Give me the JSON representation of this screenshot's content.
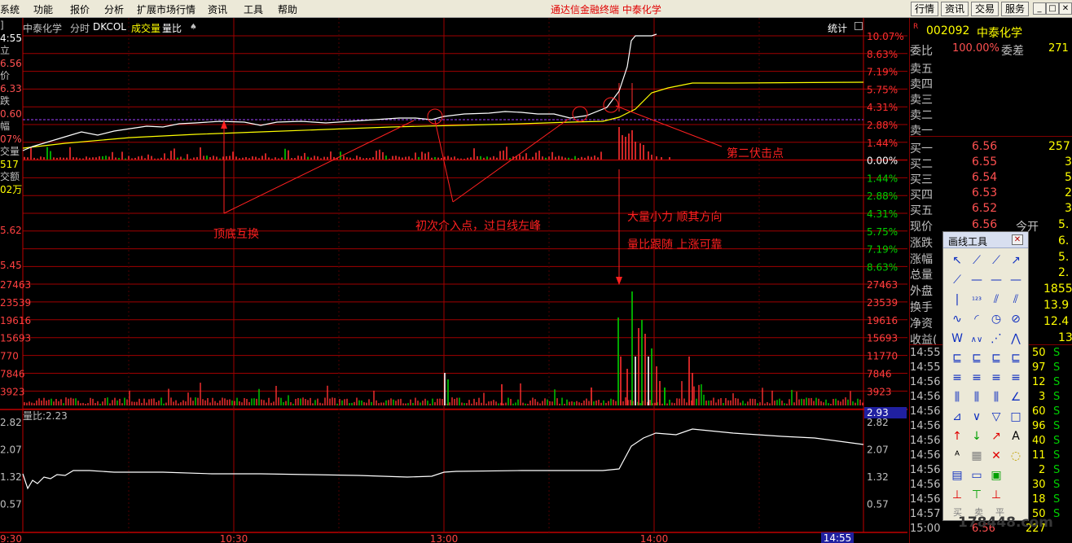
{
  "menu": [
    "系统",
    "功能",
    "报价",
    "分析",
    "扩展市场行情",
    "资讯",
    "工具",
    "帮助"
  ],
  "window_title": "通达信金融终端   中泰化学",
  "right_buttons": [
    "行情",
    "资讯",
    "交易",
    "服务"
  ],
  "window_controls": [
    "_",
    "□",
    "✕"
  ],
  "chart_header": {
    "stock": "中泰化学",
    "mode": "分时",
    "indicator": "DKCOL",
    "volume": "成交量",
    "ratio": "量比",
    "arrow": "♠",
    "stat": "统计"
  },
  "left_info": [
    {
      "text": "]",
      "color": "#c0c0c0"
    },
    {
      "text": "4:55",
      "color": "#ffffff"
    },
    {
      "text": "立",
      "color": "#c0c0c0"
    },
    {
      "text": "6.56",
      "color": "#ff5050"
    },
    {
      "text": "价",
      "color": "#c0c0c0"
    },
    {
      "text": "6.33",
      "color": "#ff5050"
    },
    {
      "text": "跌",
      "color": "#c0c0c0"
    },
    {
      "text": "0.60",
      "color": "#ff5050"
    },
    {
      "text": "幅",
      "color": "#c0c0c0"
    },
    {
      "text": "07%",
      "color": "#ff5050"
    },
    {
      "text": "交量",
      "color": "#c0c0c0"
    },
    {
      "text": "517",
      "color": "#ffff00"
    },
    {
      "text": "交额",
      "color": "#c0c0c0"
    },
    {
      "text": "02万",
      "color": "#ffff00"
    }
  ],
  "price_labels_left": [
    "5.62",
    "5.45"
  ],
  "price_labels_right": [
    "10.07%",
    "8.63%",
    "7.19%",
    "5.75%",
    "4.31%",
    "2.88%",
    "1.44%",
    "0.00%",
    "1.44%",
    "2.88%",
    "4.31%",
    "5.75%",
    "7.19%",
    "8.63%"
  ],
  "volume_labels": [
    "27463",
    "23539",
    "19616",
    "15693",
    "11770",
    "7846",
    "3923"
  ],
  "volume_labels_left": [
    "27463",
    "23539",
    "19616",
    "15693",
    "770",
    "7846",
    "3923"
  ],
  "volume_current": "2.93",
  "ratio_header": "量比:2.23",
  "ratio_labels": [
    "2.82",
    "2.07",
    "1.32",
    "0.57"
  ],
  "time_labels": [
    "9:30",
    "10:30",
    "13:00",
    "14:00"
  ],
  "time_current": "14:55",
  "annotations": [
    {
      "id": "top-bottom-swap",
      "text": "顶底互换"
    },
    {
      "id": "first-entry",
      "text": "初次介入点，过日线左峰"
    },
    {
      "id": "volume-note-1",
      "text": "大量小力 顺其方向"
    },
    {
      "id": "volume-note-2",
      "text": "量比跟随 上涨可靠"
    },
    {
      "id": "second-ambush",
      "text": "第二伏击点"
    }
  ],
  "colors": {
    "up": "#ff3030",
    "down": "#00d000",
    "price": "#ffffff",
    "avg": "#ffff00",
    "grid": "#a00000",
    "annot": "#ff2020"
  },
  "panel": {
    "code": "002092",
    "name": "中泰化学",
    "weibi_label": "委比",
    "weibi": "100.00%",
    "weicha_label": "委差",
    "weicha": "271",
    "sell": [
      "卖五",
      "卖四",
      "卖三",
      "卖二",
      "卖一"
    ],
    "buy": [
      {
        "label": "买一",
        "price": "6.56",
        "vol": "257"
      },
      {
        "label": "买二",
        "price": "6.55",
        "vol": "3"
      },
      {
        "label": "买三",
        "price": "6.54",
        "vol": "5"
      },
      {
        "label": "买四",
        "price": "6.53",
        "vol": "2"
      },
      {
        "label": "买五",
        "price": "6.52",
        "vol": "3"
      }
    ],
    "stats": [
      {
        "label": "现价",
        "v1": "6.56",
        "v1b": "今开",
        "v2": "5."
      },
      {
        "label": "涨跌",
        "v1": "",
        "v2": "6."
      },
      {
        "label": "涨幅",
        "v1": "",
        "v2": "5."
      },
      {
        "label": "总量",
        "v1": "",
        "v2": "2."
      },
      {
        "label": "外盘",
        "v1": "",
        "v2": "1855"
      },
      {
        "label": "换手",
        "v1": "",
        "v2": "13.9"
      },
      {
        "label": "净资",
        "v1": "",
        "v2": "12.4"
      },
      {
        "label": "收益(",
        "v1": "",
        "v2": "13"
      }
    ],
    "ticks": [
      {
        "t": "14:55",
        "n": "50",
        "s": "S"
      },
      {
        "t": "14:55",
        "n": "97",
        "s": "S"
      },
      {
        "t": "14:56",
        "n": "12",
        "s": "S"
      },
      {
        "t": "14:56",
        "n": "3",
        "s": "S"
      },
      {
        "t": "14:56",
        "n": "60",
        "s": "S"
      },
      {
        "t": "14:56",
        "n": "96",
        "s": "S"
      },
      {
        "t": "14:56",
        "n": "40",
        "s": "S"
      },
      {
        "t": "14:56",
        "n": "11",
        "s": "S"
      },
      {
        "t": "14:56",
        "n": "2",
        "s": "S"
      },
      {
        "t": "14:56",
        "n": "30",
        "s": "S"
      },
      {
        "t": "14:56",
        "n": "18",
        "s": "S"
      },
      {
        "t": "14:57",
        "p": "6.56",
        "n": "50",
        "s": "S"
      },
      {
        "t": "15:00",
        "p": "6.56",
        "n": "227",
        "s": ""
      }
    ]
  },
  "tools": {
    "title": "画线工具",
    "close": "✕",
    "bottom": [
      "买",
      "卖",
      "平"
    ]
  },
  "watermark": "178448.com"
}
